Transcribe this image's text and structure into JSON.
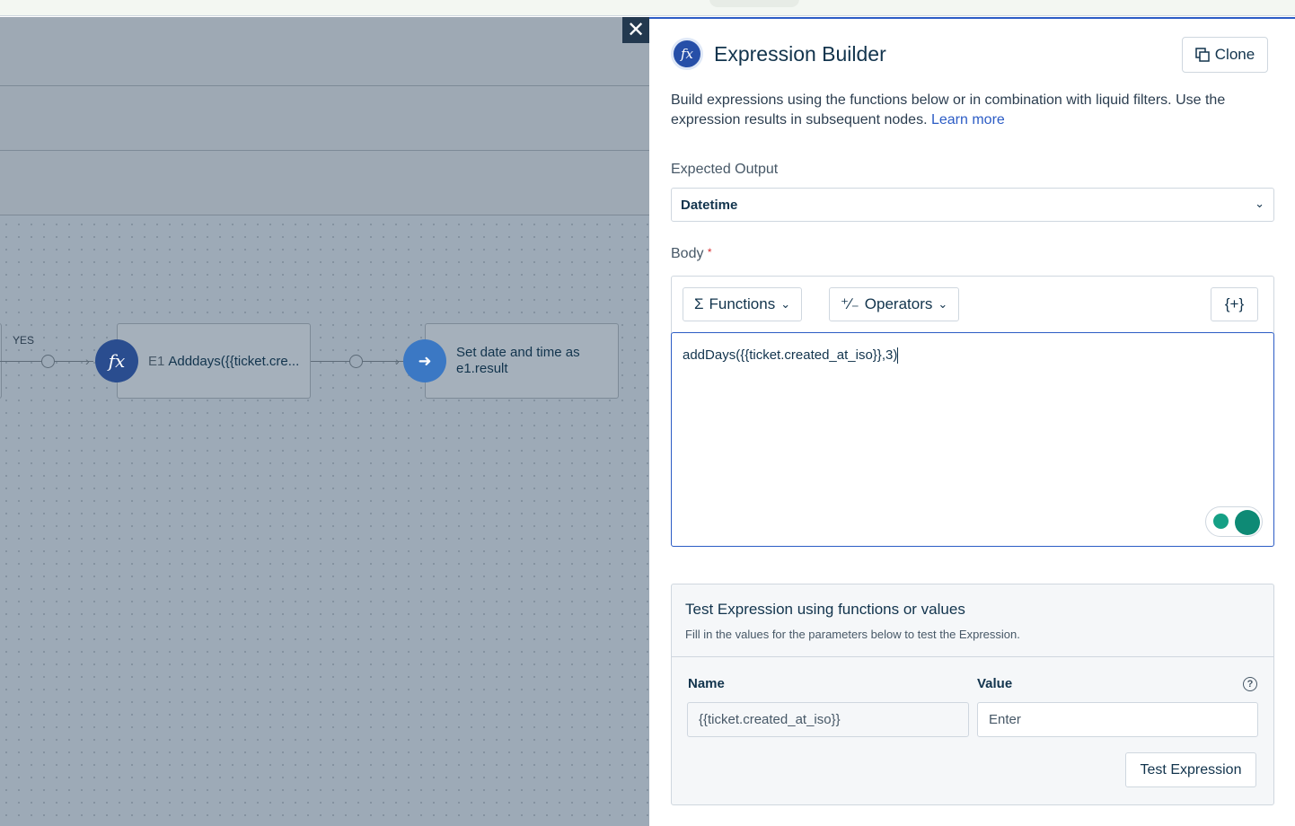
{
  "canvas": {
    "yes_label": "YES",
    "node_expression": {
      "prefix": "E1",
      "label": "Adddays({{ticket.cre..."
    },
    "node_action": {
      "label": "Set date and time as e1.result"
    }
  },
  "panel": {
    "title": "Expression Builder",
    "clone_label": "Clone",
    "description": "Build expressions using the functions below or in combination with liquid filters. Use the expression results in subsequent nodes.",
    "learn_more": "Learn more",
    "expected_output_label": "Expected Output",
    "expected_output_value": "Datetime",
    "body_label": "Body",
    "body_required": "*",
    "functions_label": "Functions",
    "operators_label": "Operators",
    "placeholder_button": "{+}",
    "expression": "addDays({{ticket.created_at_iso}},3)",
    "test": {
      "title": "Test Expression using functions or values",
      "subtitle": "Fill in the values for the parameters below to test the Expression.",
      "name_header": "Name",
      "value_header": "Value",
      "param_name": "{{ticket.created_at_iso}}",
      "value_placeholder": "Enter",
      "button_label": "Test Expression"
    }
  },
  "colors": {
    "accent": "#2c5cc5",
    "text": "#12344d",
    "canvas": "#9daab7"
  }
}
